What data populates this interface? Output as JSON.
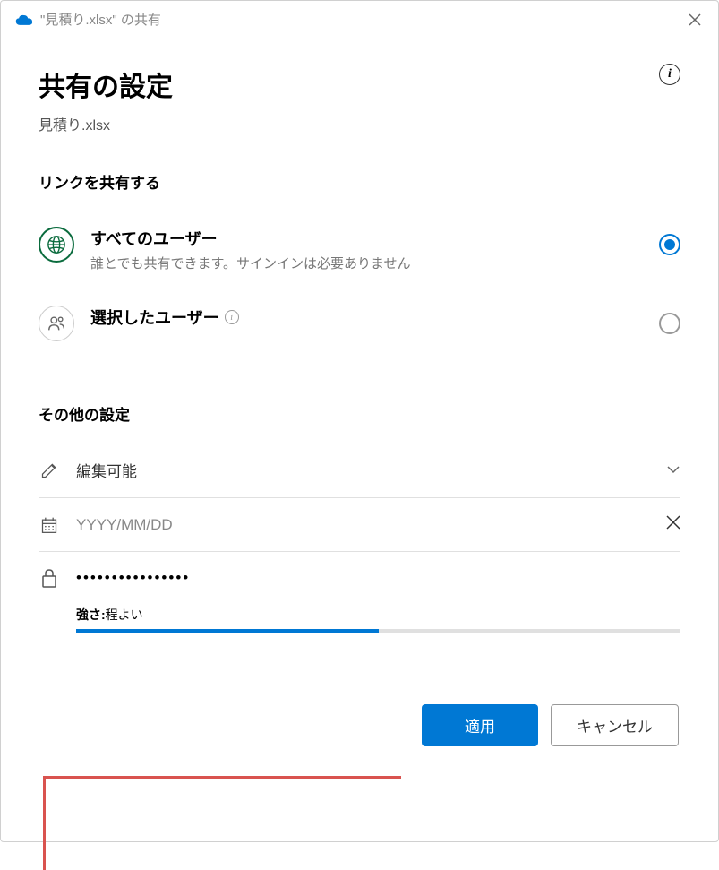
{
  "titleBar": {
    "text": "\"見積り.xlsx\" の共有"
  },
  "header": {
    "title": "共有の設定",
    "filename": "見積り.xlsx"
  },
  "shareSection": {
    "label": "リンクを共有する",
    "options": {
      "everyone": {
        "title": "すべてのユーザー",
        "desc": "誰とでも共有できます。サインインは必要ありません"
      },
      "selected": {
        "title": "選択したユーザー"
      }
    }
  },
  "otherSettings": {
    "label": "その他の設定",
    "permission": "編集可能",
    "datePlaceholder": "YYYY/MM/DD",
    "passwordMask": "••••••••••••••••",
    "strengthLabel": "強さ:",
    "strengthValue": "程よい"
  },
  "buttons": {
    "apply": "適用",
    "cancel": "キャンセル"
  }
}
